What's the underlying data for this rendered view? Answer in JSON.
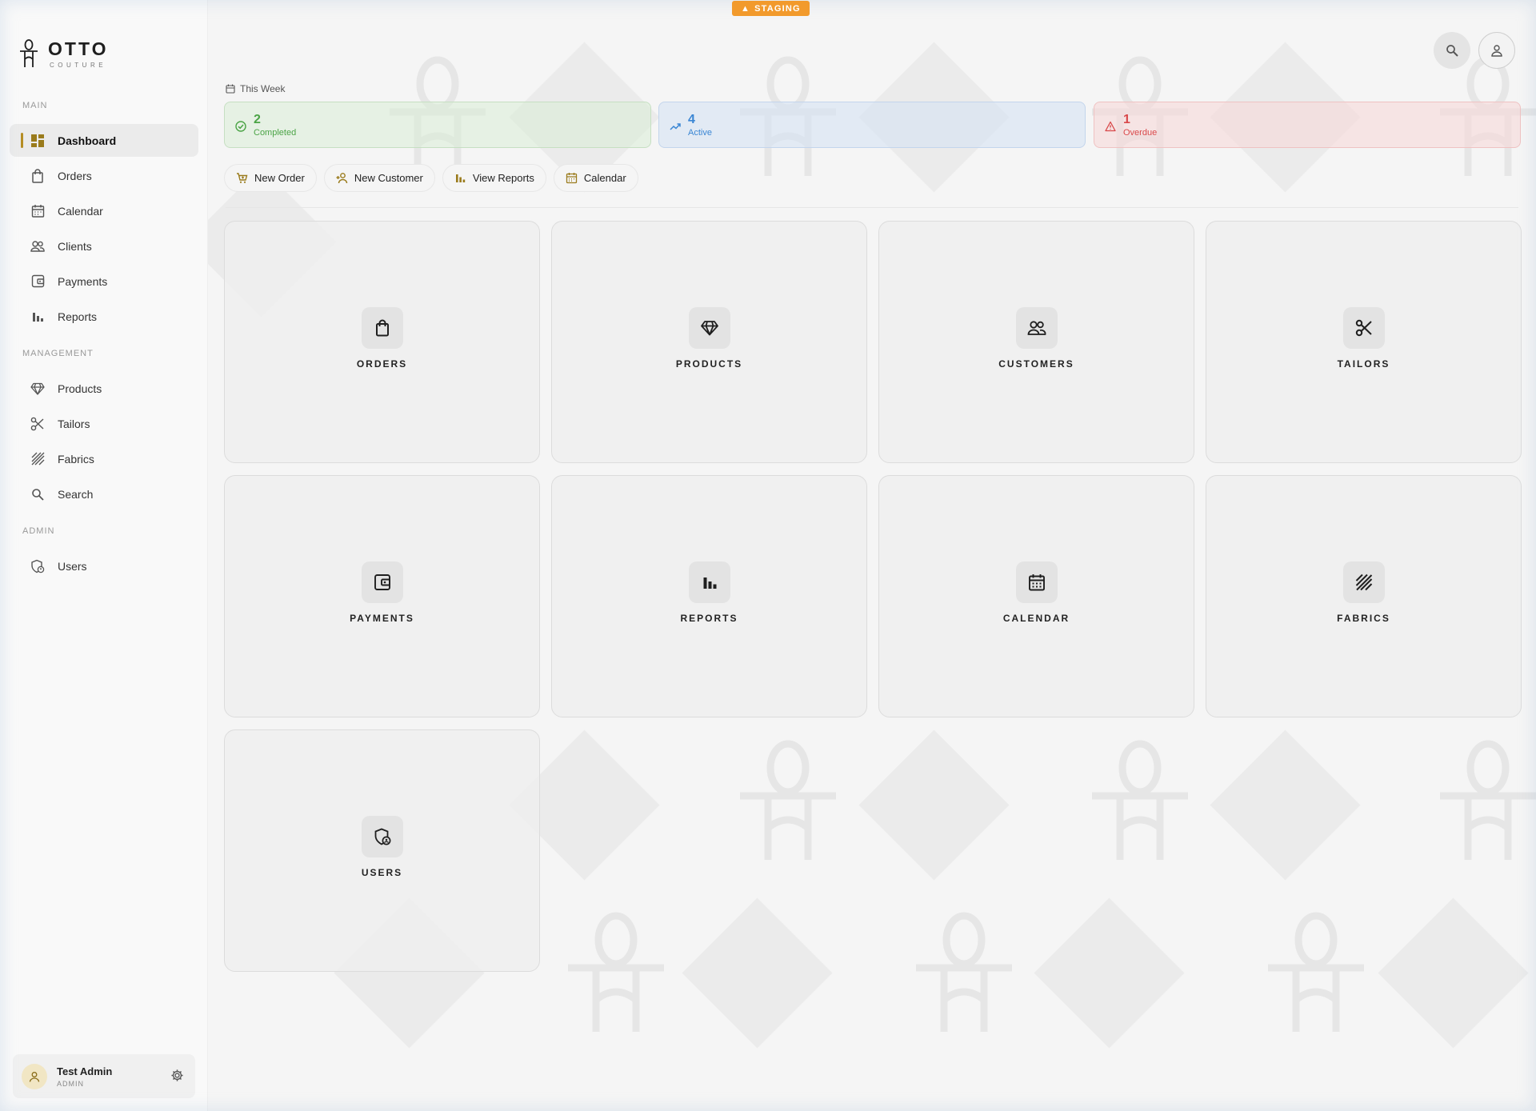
{
  "badge": {
    "text": "STAGING"
  },
  "brand": {
    "title": "OTTO",
    "subtitle": "COUTURE"
  },
  "sidebar": {
    "sections": [
      {
        "heading": "MAIN",
        "items": [
          {
            "label": "Dashboard",
            "icon": "dashboard-icon",
            "active": true
          },
          {
            "label": "Orders",
            "icon": "shopping-bag-icon"
          },
          {
            "label": "Calendar",
            "icon": "calendar-icon"
          },
          {
            "label": "Clients",
            "icon": "users-icon"
          },
          {
            "label": "Payments",
            "icon": "wallet-icon"
          },
          {
            "label": "Reports",
            "icon": "bar-chart-icon"
          }
        ]
      },
      {
        "heading": "MANAGEMENT",
        "items": [
          {
            "label": "Products",
            "icon": "diamond-icon"
          },
          {
            "label": "Tailors",
            "icon": "scissors-icon"
          },
          {
            "label": "Fabrics",
            "icon": "fabric-icon"
          },
          {
            "label": "Search",
            "icon": "search-icon"
          }
        ]
      },
      {
        "heading": "ADMIN",
        "items": [
          {
            "label": "Users",
            "icon": "shield-user-icon"
          }
        ]
      }
    ]
  },
  "user": {
    "name": "Test Admin",
    "role": "ADMIN"
  },
  "week": {
    "label": "This Week"
  },
  "stats": {
    "completed": {
      "value": "2",
      "label": "Completed",
      "color": "#4ba446"
    },
    "active": {
      "value": "4",
      "label": "Active",
      "color": "#3a86d4"
    },
    "overdue": {
      "value": "1",
      "label": "Overdue",
      "color": "#d8484a"
    }
  },
  "actions": [
    {
      "label": "New Order",
      "icon": "cart-plus-icon"
    },
    {
      "label": "New Customer",
      "icon": "user-plus-icon"
    },
    {
      "label": "View Reports",
      "icon": "bar-chart-icon"
    },
    {
      "label": "Calendar",
      "icon": "calendar-icon"
    }
  ],
  "tiles": [
    {
      "label": "ORDERS",
      "icon": "shopping-bag-icon"
    },
    {
      "label": "PRODUCTS",
      "icon": "diamond-icon"
    },
    {
      "label": "CUSTOMERS",
      "icon": "users-icon"
    },
    {
      "label": "TAILORS",
      "icon": "scissors-icon"
    },
    {
      "label": "PAYMENTS",
      "icon": "wallet-icon"
    },
    {
      "label": "REPORTS",
      "icon": "bar-chart-icon"
    },
    {
      "label": "CALENDAR",
      "icon": "calendar-icon"
    },
    {
      "label": "FABRICS",
      "icon": "fabric-icon"
    },
    {
      "label": "USERS",
      "icon": "shield-user-icon"
    }
  ],
  "colors": {
    "accent": "#b58d24",
    "staging": "#f29a2c"
  }
}
